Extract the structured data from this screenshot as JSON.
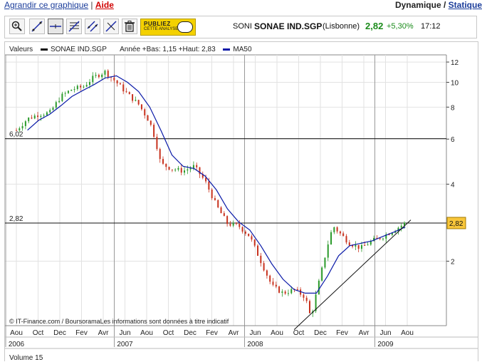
{
  "nav": {
    "enlarge_link": "Agrandir ce graphique",
    "separator": "|",
    "help_link": "Aide",
    "mode_dynamic": "Dynamique",
    "mode_sep": " / ",
    "mode_static": "Statique"
  },
  "toolbar": {
    "tools": [
      "zoom-tool",
      "trendline-tool",
      "horizontal-line-tool",
      "fibonacci-tool",
      "channel-tool",
      "parallel-lines-tool",
      "delete-tool"
    ],
    "publish_line1": "PUBLIEZ",
    "publish_line2": "CETTE ANALYSE"
  },
  "quote": {
    "code": "SONI",
    "name": "SONAE IND.SGP",
    "market": "(Lisbonne)",
    "price": "2,82",
    "change": "+5,30%",
    "time": "17:12",
    "color_up": "#1c8c1c"
  },
  "legend": {
    "title": "Valeurs",
    "series_name": "SONAE IND.SGP",
    "range_text": "Année +Bas: 1,15 +Haut: 2,83",
    "ma_name": "MA50",
    "series_color": "#111111",
    "ma_color": "#0a1aa8"
  },
  "credit": "© IT-Finance.com / BoursoramaLes informations sont données à titre indicatif",
  "volume_label": "Volume 15",
  "chart_data": {
    "type": "candlestick",
    "y_scale": "log",
    "ylim": [
      1.12,
      12.8
    ],
    "y_ticks": [
      2,
      4,
      6,
      8,
      10,
      12
    ],
    "h_lines": [
      {
        "value": 6.02,
        "label": "6,02"
      },
      {
        "value": 2.82,
        "label": "2,82"
      }
    ],
    "last_value_label": "2,82",
    "x_months": [
      "Aou",
      "Oct",
      "Dec",
      "Fev",
      "Avr",
      "Jun",
      "Aou",
      "Oct",
      "Dec",
      "Fev",
      "Avr",
      "Jun",
      "Aou",
      "Oct",
      "Dec",
      "Fev",
      "Avr",
      "Jun",
      "Aou"
    ],
    "x_years": [
      {
        "label": "2006",
        "month_index": 0
      },
      {
        "label": "2007",
        "month_index": 5
      },
      {
        "label": "2008",
        "month_index": 11
      },
      {
        "label": "2009",
        "month_index": 17
      }
    ],
    "price_path": [
      [
        0,
        6.5
      ],
      [
        2,
        7.2
      ],
      [
        4,
        7.5
      ],
      [
        6,
        7.6
      ],
      [
        8,
        8.8
      ],
      [
        10,
        9.4
      ],
      [
        12,
        9.6
      ],
      [
        14,
        10.5
      ],
      [
        16,
        11.0
      ],
      [
        18,
        10.0
      ],
      [
        20,
        9.0
      ],
      [
        22,
        8.2
      ],
      [
        24,
        7.0
      ],
      [
        25,
        6.0
      ],
      [
        26,
        4.8
      ],
      [
        28,
        4.6
      ],
      [
        30,
        4.5
      ],
      [
        32,
        4.7
      ],
      [
        34,
        4.1
      ],
      [
        36,
        3.3
      ],
      [
        38,
        2.8
      ],
      [
        40,
        2.75
      ],
      [
        42,
        2.5
      ],
      [
        44,
        2.0
      ],
      [
        46,
        1.6
      ],
      [
        48,
        1.5
      ],
      [
        50,
        1.55
      ],
      [
        52,
        1.45
      ],
      [
        53,
        1.2
      ],
      [
        54,
        1.5
      ],
      [
        56,
        2.3
      ],
      [
        57,
        2.75
      ],
      [
        58,
        2.6
      ],
      [
        60,
        2.35
      ],
      [
        62,
        2.25
      ],
      [
        64,
        2.4
      ],
      [
        66,
        2.5
      ],
      [
        68,
        2.65
      ],
      [
        70,
        2.82
      ]
    ],
    "ma50_path": [
      [
        2,
        6.5
      ],
      [
        4,
        7.1
      ],
      [
        6,
        7.5
      ],
      [
        8,
        8.1
      ],
      [
        10,
        8.8
      ],
      [
        12,
        9.3
      ],
      [
        14,
        9.8
      ],
      [
        16,
        10.4
      ],
      [
        18,
        10.6
      ],
      [
        20,
        10.0
      ],
      [
        22,
        9.2
      ],
      [
        24,
        8.0
      ],
      [
        26,
        6.5
      ],
      [
        28,
        5.2
      ],
      [
        30,
        4.7
      ],
      [
        32,
        4.6
      ],
      [
        34,
        4.3
      ],
      [
        36,
        3.8
      ],
      [
        38,
        3.2
      ],
      [
        40,
        2.85
      ],
      [
        42,
        2.65
      ],
      [
        44,
        2.3
      ],
      [
        46,
        1.95
      ],
      [
        48,
        1.7
      ],
      [
        50,
        1.55
      ],
      [
        52,
        1.5
      ],
      [
        54,
        1.5
      ],
      [
        56,
        1.75
      ],
      [
        58,
        2.1
      ],
      [
        60,
        2.3
      ],
      [
        62,
        2.35
      ],
      [
        64,
        2.4
      ],
      [
        66,
        2.5
      ],
      [
        68,
        2.6
      ],
      [
        70,
        2.72
      ]
    ],
    "trendline": [
      [
        50,
        1.08
      ],
      [
        71,
        2.9
      ]
    ]
  }
}
